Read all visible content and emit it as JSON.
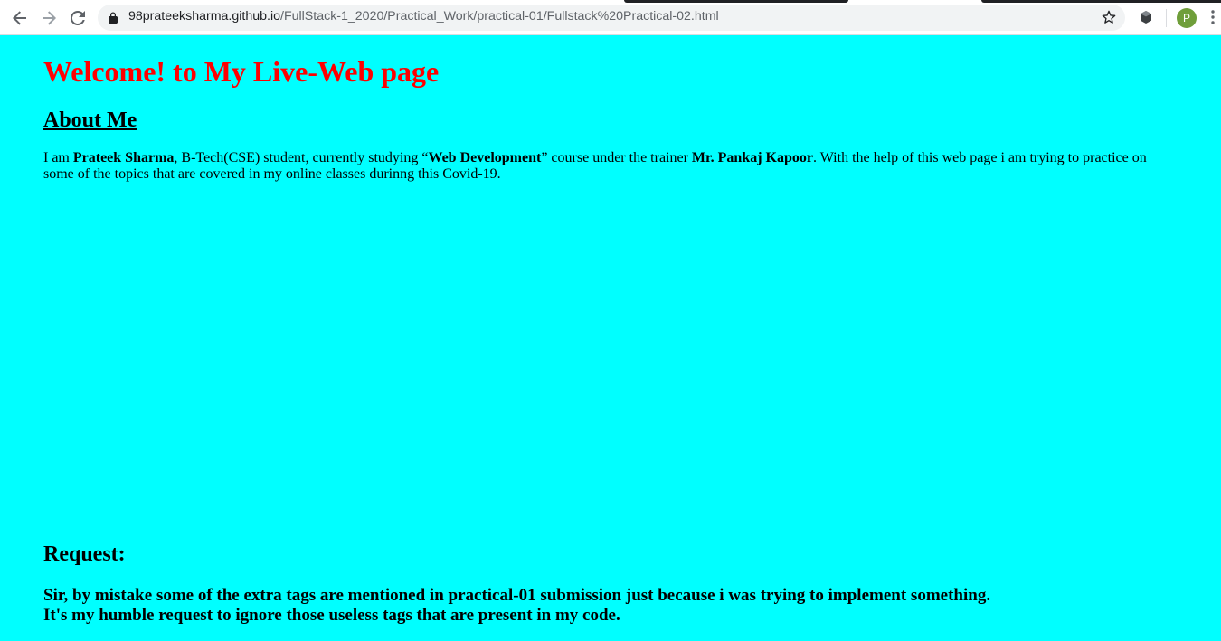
{
  "browser": {
    "url_host": "98prateeksharma.github.io",
    "url_path": "/FullStack-1_2020/Practical_Work/practical-01/Fullstack%20Practical-02.html",
    "profile_initial": "P",
    "icons": [
      "back-arrow-icon",
      "forward-arrow-icon",
      "reload-icon",
      "lock-icon",
      "star-icon",
      "extension-icon",
      "menu-dots-icon"
    ]
  },
  "page": {
    "title": "Welcome! to My Live-Web page",
    "about_heading": "About Me",
    "about": {
      "t1": "I am ",
      "name": "Prateek Sharma",
      "t2": ", B-Tech(CSE) student, currently studying “",
      "course": "Web Development",
      "t3": "” course under the trainer ",
      "trainer": "Mr. Pankaj Kapoor",
      "t4": ". With the help of this web page i am trying to practice on some of the topics that are covered in my online classes durinng this Covid-19."
    },
    "request_heading": "Request:",
    "request_line1": "Sir, by mistake some of the extra tags are mentioned in practical-01 submission just because i was trying to implement something.",
    "request_line2": "It's my humble request to ignore those useless tags that are present in my code."
  },
  "colors": {
    "page_background": "#00ffff",
    "title": "#ff0000",
    "text": "#000000"
  }
}
